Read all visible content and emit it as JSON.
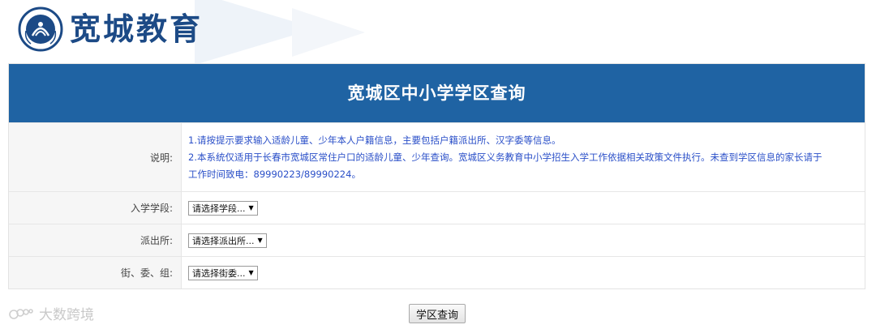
{
  "header": {
    "logo_text": "宽城教育",
    "emblem_ring_text": "KUANCHENG EDUCATION"
  },
  "panel": {
    "title": "宽城区中小学学区查询"
  },
  "description": {
    "label": "说明:",
    "line1": "1.请按提示要求输入适龄儿童、少年本人户籍信息，主要包括户籍派出所、汉字委等信息。",
    "line2": "2.本系统仅适用于长春市宽城区常住户口的适龄儿童、少年查询。宽城区义务教育中小学招生入学工作依据相关政策文件执行。未查到学区信息的家长请于",
    "line3": "工作时间致电：89990223/89990224。"
  },
  "fields": {
    "stage": {
      "label": "入学学段:",
      "selected": "请选择学段..."
    },
    "police": {
      "label": "派出所:",
      "selected": "请选择派出所..."
    },
    "street": {
      "label": "街、委、组:",
      "selected": "请选择街委..."
    }
  },
  "actions": {
    "query_label": "学区查询"
  },
  "watermark": {
    "text": "大数跨境"
  },
  "colors": {
    "brand_blue": "#1f63a3",
    "desc_text": "#2a4fc8",
    "logo_blue": "#1c4a86"
  }
}
